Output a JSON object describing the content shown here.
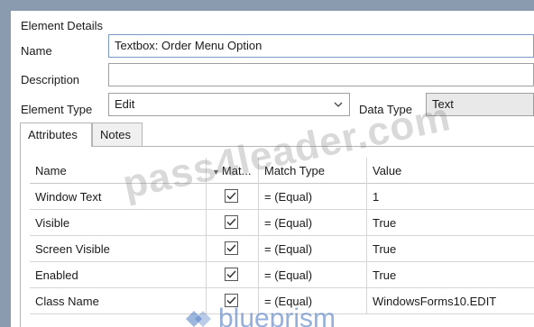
{
  "group_title": "Element Details",
  "name": {
    "label": "Name",
    "value": "Textbox: Order Menu Option"
  },
  "description": {
    "label": "Description",
    "value": ""
  },
  "element_type": {
    "label": "Element Type",
    "value": "Edit"
  },
  "data_type": {
    "label": "Data Type",
    "value": "Text"
  },
  "tabs": [
    {
      "label": "Attributes",
      "selected": true
    },
    {
      "label": "Notes",
      "selected": false
    }
  ],
  "grid": {
    "headers": {
      "name": "Name",
      "match": "Mat...",
      "match_type": "Match Type",
      "value": "Value"
    },
    "rows": [
      {
        "name": "Window Text",
        "checked": true,
        "match_type": "= (Equal)",
        "value": "1"
      },
      {
        "name": "Visible",
        "checked": true,
        "match_type": "= (Equal)",
        "value": "True"
      },
      {
        "name": "Screen Visible",
        "checked": true,
        "match_type": "= (Equal)",
        "value": "True"
      },
      {
        "name": "Enabled",
        "checked": true,
        "match_type": "= (Equal)",
        "value": "True"
      },
      {
        "name": "Class Name",
        "checked": true,
        "match_type": "= (Equal)",
        "value": "WindowsForms10.EDIT"
      }
    ]
  },
  "watermark": "pass4leader.com",
  "brand": "blueprism",
  "colors": {
    "background": "#8a9bb0",
    "panel": "#ffffff",
    "border": "#a0a0a0"
  }
}
